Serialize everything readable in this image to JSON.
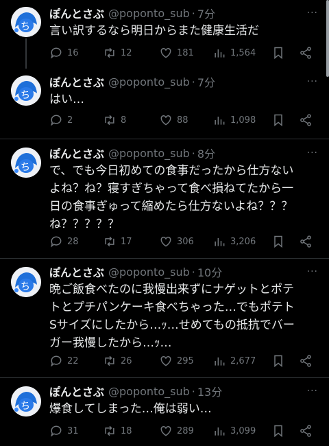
{
  "tweets": [
    {
      "name": "ぽんとさぶ",
      "handle": "@poponto_sub",
      "time": "7分",
      "text": "言い訳するなら明日からまた健康生活だ",
      "replies": "16",
      "retweets": "12",
      "likes": "181",
      "views": "1,564"
    },
    {
      "name": "ぽんとさぶ",
      "handle": "@poponto_sub",
      "time": "7分",
      "text": "はい…",
      "replies": "2",
      "retweets": "8",
      "likes": "88",
      "views": "1,098"
    },
    {
      "name": "ぽんとさぶ",
      "handle": "@poponto_sub",
      "time": "8分",
      "text": "で、でも今日初めての食事だったから仕方ない\nよね？ね？寝すぎちゃって食べ損ねてたから一\n日の食事ぎゅって縮めたら仕方ないよね？？？\nね？？？？？",
      "replies": "28",
      "retweets": "17",
      "likes": "306",
      "views": "3,206"
    },
    {
      "name": "ぽんとさぶ",
      "handle": "@poponto_sub",
      "time": "10分",
      "text": "晩ご飯食べたのに我慢出来ずにナゲットとポテ\nトとプチパンケーキ食べちゃった…でもポテト\nSサイズにしたから…ｯ…せめてもの抵抗でバー\nガー我慢したから…ｯ…",
      "replies": "22",
      "retweets": "26",
      "likes": "295",
      "views": "2,677"
    },
    {
      "name": "ぽんとさぶ",
      "handle": "@poponto_sub",
      "time": "13分",
      "text": "爆食してしまった…俺は弱い…",
      "replies": "31",
      "retweets": "18",
      "likes": "289",
      "views": "3,099"
    }
  ],
  "colors": {
    "background": "#000000",
    "text": "#e7e9ea",
    "muted": "#71767b",
    "divider": "#2f3336"
  }
}
